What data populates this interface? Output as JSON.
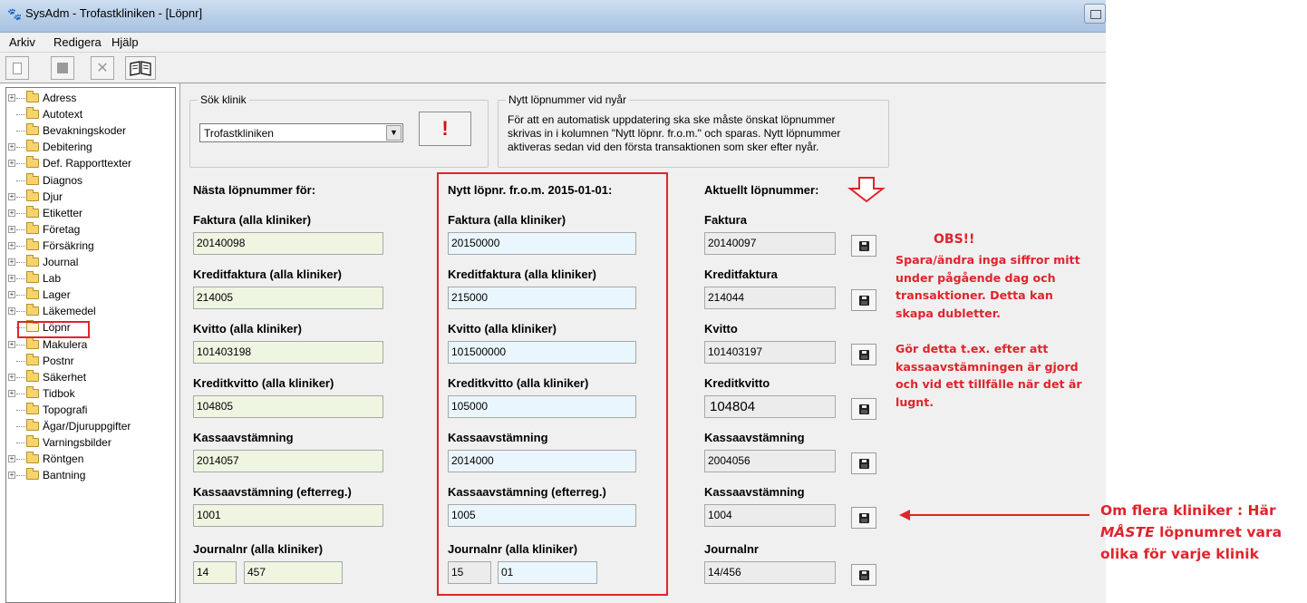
{
  "window": {
    "title": "SysAdm - Trofastkliniken - [Löpnr]"
  },
  "menu": [
    "Arkiv",
    "Redigera",
    "Hjälp"
  ],
  "toolbar": {
    "new_icon": "new-document-icon",
    "save_icon": "save-disk-icon",
    "delete_icon": "close-x-icon",
    "book_icon": "open-book-icon"
  },
  "tree": {
    "items": [
      {
        "label": "Adress",
        "expandable": true
      },
      {
        "label": "Autotext",
        "expandable": false
      },
      {
        "label": "Bevakningskoder",
        "expandable": false
      },
      {
        "label": "Debitering",
        "expandable": true
      },
      {
        "label": "Def. Rapporttexter",
        "expandable": true
      },
      {
        "label": "Diagnos",
        "expandable": false
      },
      {
        "label": "Djur",
        "expandable": true
      },
      {
        "label": "Etiketter",
        "expandable": true
      },
      {
        "label": "Företag",
        "expandable": true
      },
      {
        "label": "Försäkring",
        "expandable": true
      },
      {
        "label": "Journal",
        "expandable": true
      },
      {
        "label": "Lab",
        "expandable": true
      },
      {
        "label": "Lager",
        "expandable": true
      },
      {
        "label": "Läkemedel",
        "expandable": true
      },
      {
        "label": "Löpnr",
        "expandable": false,
        "selected": true
      },
      {
        "label": "Makulera",
        "expandable": true
      },
      {
        "label": "Postnr",
        "expandable": false
      },
      {
        "label": "Säkerhet",
        "expandable": true
      },
      {
        "label": "Tidbok",
        "expandable": true
      },
      {
        "label": "Topografi",
        "expandable": false
      },
      {
        "label": "Ägar/Djuruppgifter",
        "expandable": false
      },
      {
        "label": "Varningsbilder",
        "expandable": false
      },
      {
        "label": "Röntgen",
        "expandable": true
      },
      {
        "label": "Bantning",
        "expandable": true
      }
    ]
  },
  "search": {
    "legend": "Sök klinik",
    "selected": "Trofastkliniken",
    "button_label": "!"
  },
  "newyear": {
    "legend": "Nytt löpnummer vid nyår",
    "lines": [
      "För att en automatisk uppdatering ska ske måste önskat löpnummer",
      "skrivas in i kolumnen \"Nytt löpnr. fr.o.m.\" och sparas.  Nytt löpnummer",
      "aktiveras sedan vid den första transaktionen som sker efter nyår."
    ]
  },
  "columns": {
    "next": "Nästa löpnummer för:",
    "new": "Nytt löpnr. fr.o.m. 2015-01-01:",
    "current": "Aktuellt löpnummer:"
  },
  "rows": [
    {
      "next_label": "Faktura (alla kliniker)",
      "next_value": "20140098",
      "new_label": "Faktura (alla kliniker)",
      "new_value": "20150000",
      "cur_label": "Faktura",
      "cur_value": "20140097"
    },
    {
      "next_label": "Kreditfaktura (alla kliniker)",
      "next_value": "214005",
      "new_label": "Kreditfaktura (alla kliniker)",
      "new_value": "215000",
      "cur_label": "Kreditfaktura",
      "cur_value": "214044"
    },
    {
      "next_label": "Kvitto (alla kliniker)",
      "next_value": "101403198",
      "new_label": "Kvitto (alla kliniker)",
      "new_value": "101500000",
      "cur_label": "Kvitto",
      "cur_value": "101403197"
    },
    {
      "next_label": "Kreditkvitto (alla kliniker)",
      "next_value": "104805",
      "new_label": "Kreditkvitto (alla kliniker)",
      "new_value": "105000",
      "cur_label": "Kreditkvitto",
      "cur_value": "104804"
    },
    {
      "next_label": "Kassaavstämning",
      "next_value": "2014057",
      "new_label": "Kassaavstämning",
      "new_value": "2014000",
      "cur_label": "Kassaavstämning",
      "cur_value": "2004056"
    },
    {
      "next_label": "Kassaavstämning (efterreg.)",
      "next_value": "1001",
      "new_label": "Kassaavstämning (efterreg.)",
      "new_value": "1005",
      "cur_label": "Kassaavstämning",
      "cur_value": "1004"
    }
  ],
  "journal": {
    "next_label": "Journalnr (alla kliniker)",
    "next_a": "14",
    "next_b": "457",
    "new_label": "Journalnr (alla kliniker)",
    "new_a": "15",
    "new_b": "01",
    "cur_label": "Journalnr",
    "cur_value": "14/456"
  },
  "notes": {
    "obs_title": "OBS!!",
    "obs_lines": [
      "Spara/ändra inga siffror mitt",
      "under pågående dag och",
      "transaktioner. Detta kan",
      "skapa dubletter.",
      "",
      "Gör detta t.ex. efter att",
      "kassaavstämningen är gjord",
      "och vid ett tillfälle när det är",
      "lugnt."
    ],
    "multi_line1": "Om flera kliniker : Här",
    "multi_line2_em": "MÅSTE",
    "multi_line2_rest": " löpnumret vara",
    "multi_line3": "olika för varje klinik"
  },
  "colors": {
    "highlight": "#e0242b",
    "next_field": "#eef6e2",
    "new_field": "#eaf6fd"
  }
}
